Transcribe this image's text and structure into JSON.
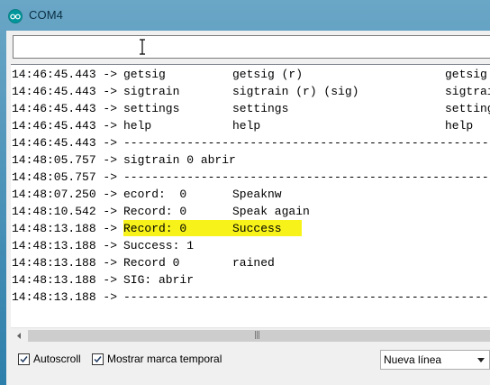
{
  "window": {
    "title": "COM4",
    "icon": "arduino-logo-icon"
  },
  "send_input": {
    "value": "",
    "cursor_icon": "text-cursor-icon"
  },
  "serial_log": [
    {
      "time": "14:46:45.443 ->",
      "cols": [
        "getsig",
        "getsig (r)",
        "getsig"
      ]
    },
    {
      "time": "14:46:45.443 ->",
      "cols": [
        "sigtrain",
        "sigtrain (r) (sig)",
        "sigtrain"
      ]
    },
    {
      "time": "14:46:45.443 ->",
      "cols": [
        "settings",
        "settings",
        "settings"
      ]
    },
    {
      "time": "14:46:45.443 ->",
      "cols": [
        "help",
        "help",
        "help"
      ]
    },
    {
      "time": "14:46:45.443 ->",
      "cols": [
        "----------------------------------------------------------",
        "",
        ""
      ]
    },
    {
      "time": "14:48:05.757 ->",
      "cols": [
        "sigtrain 0 abrir",
        "",
        ""
      ]
    },
    {
      "time": "14:48:05.757 ->",
      "cols": [
        "----------------------------------------------------------",
        "",
        ""
      ]
    },
    {
      "time": "14:48:07.250 ->",
      "cols": [
        "ecord:  0",
        "Speaknw",
        ""
      ]
    },
    {
      "time": "14:48:10.542 ->",
      "cols": [
        "Record: 0",
        "Speak again",
        ""
      ]
    },
    {
      "time": "14:48:13.188 ->",
      "cols": [
        "Record: 0",
        "Success",
        ""
      ]
    },
    {
      "time": "14:48:13.188 ->",
      "cols": [
        "Success: 1",
        "",
        ""
      ]
    },
    {
      "time": "14:48:13.188 ->",
      "cols": [
        "Record 0",
        "rained",
        ""
      ]
    },
    {
      "time": "14:48:13.188 ->",
      "cols": [
        "SIG: abrir",
        "",
        ""
      ]
    },
    {
      "time": "14:48:13.188 ->",
      "cols": [
        "----------------------------------------------------------",
        "",
        ""
      ]
    }
  ],
  "highlight": {
    "line_index": 9,
    "color": "#f7f31a"
  },
  "footer": {
    "autoscroll": {
      "label": "Autoscroll",
      "checked": true
    },
    "timestamp": {
      "label": "Mostrar marca temporal",
      "checked": true
    },
    "line_ending": {
      "value": "Nueva línea"
    }
  },
  "colors": {
    "titlebar": "#2d7fab",
    "icon_teal": "#00979c",
    "highlight": "#f7f31a"
  }
}
